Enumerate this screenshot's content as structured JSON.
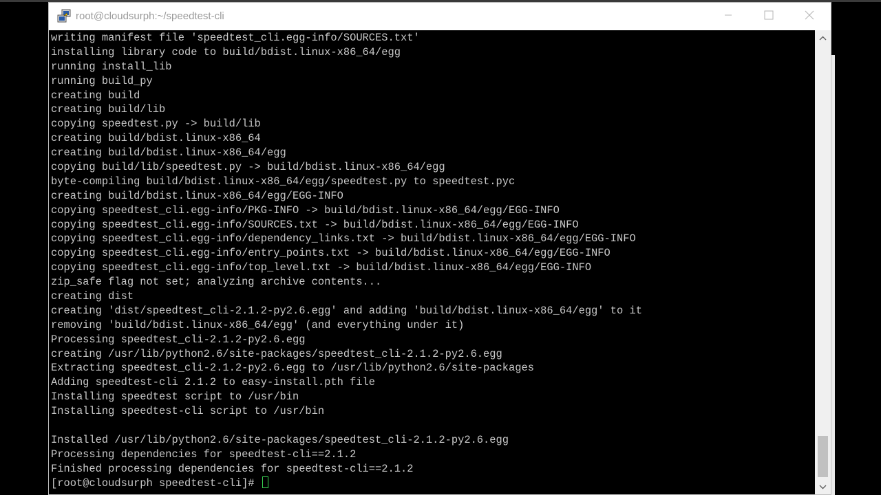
{
  "window": {
    "title": "root@cloudsurph:~/speedtest-cli",
    "app_icon": "putty-icon"
  },
  "controls": {
    "minimize_icon": "minimize-icon",
    "maximize_icon": "maximize-icon",
    "close_icon": "close-icon"
  },
  "terminal": {
    "lines": [
      "writing manifest file 'speedtest_cli.egg-info/SOURCES.txt'",
      "installing library code to build/bdist.linux-x86_64/egg",
      "running install_lib",
      "running build_py",
      "creating build",
      "creating build/lib",
      "copying speedtest.py -> build/lib",
      "creating build/bdist.linux-x86_64",
      "creating build/bdist.linux-x86_64/egg",
      "copying build/lib/speedtest.py -> build/bdist.linux-x86_64/egg",
      "byte-compiling build/bdist.linux-x86_64/egg/speedtest.py to speedtest.pyc",
      "creating build/bdist.linux-x86_64/egg/EGG-INFO",
      "copying speedtest_cli.egg-info/PKG-INFO -> build/bdist.linux-x86_64/egg/EGG-INFO",
      "copying speedtest_cli.egg-info/SOURCES.txt -> build/bdist.linux-x86_64/egg/EGG-INFO",
      "copying speedtest_cli.egg-info/dependency_links.txt -> build/bdist.linux-x86_64/egg/EGG-INFO",
      "copying speedtest_cli.egg-info/entry_points.txt -> build/bdist.linux-x86_64/egg/EGG-INFO",
      "copying speedtest_cli.egg-info/top_level.txt -> build/bdist.linux-x86_64/egg/EGG-INFO",
      "zip_safe flag not set; analyzing archive contents...",
      "creating dist",
      "creating 'dist/speedtest_cli-2.1.2-py2.6.egg' and adding 'build/bdist.linux-x86_64/egg' to it",
      "removing 'build/bdist.linux-x86_64/egg' (and everything under it)",
      "Processing speedtest_cli-2.1.2-py2.6.egg",
      "creating /usr/lib/python2.6/site-packages/speedtest_cli-2.1.2-py2.6.egg",
      "Extracting speedtest_cli-2.1.2-py2.6.egg to /usr/lib/python2.6/site-packages",
      "Adding speedtest-cli 2.1.2 to easy-install.pth file",
      "Installing speedtest script to /usr/bin",
      "Installing speedtest-cli script to /usr/bin",
      "",
      "Installed /usr/lib/python2.6/site-packages/speedtest_cli-2.1.2-py2.6.egg",
      "Processing dependencies for speedtest-cli==2.1.2",
      "Finished processing dependencies for speedtest-cli==2.1.2"
    ],
    "prompt": "[root@cloudsurph speedtest-cli]# ",
    "cursor_color": "#39d353"
  },
  "scrollbar": {
    "up_icon": "scroll-up-arrow-icon",
    "down_icon": "scroll-down-arrow-icon"
  }
}
